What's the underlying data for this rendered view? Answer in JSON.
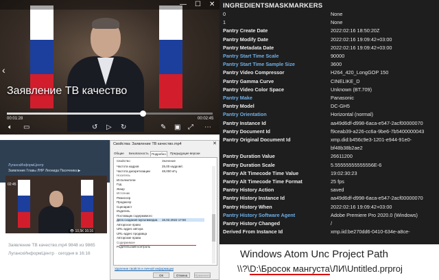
{
  "player": {
    "caption": "Заявление ТВ качество",
    "time_current": "00:01:28",
    "time_total": "00:02:45",
    "progress": 0.66,
    "flag_colors": [
      "#ffffff",
      "#1c3f9e",
      "#d21e2c"
    ]
  },
  "post": {
    "channel_header": "ЛуганскИнформЦентр",
    "subtitle": "Заявление Главы ЛНР Леонида Пасечника ▶",
    "duration": "02:45",
    "video_meta": "👁 10,5К 16:16",
    "file_info": "Заявление ТВ качество.mp4 9848 из 9865",
    "channel_time": "ЛуганскИнформЦентр · сегодня в 16:16"
  },
  "dialog": {
    "title": "Свойства: Заявление ТВ качество.mp4",
    "tabs": [
      "Общие",
      "Безопасность",
      "Подробно",
      "Предыдущие версии"
    ],
    "col_property": "Свойство",
    "col_value": "Значение",
    "rows": [
      {
        "label": "Частота кадров",
        "value": "25,00 кадров/с",
        "kind": "item"
      },
      {
        "label": "Частота дискретизации",
        "value": "48,000 кГц",
        "kind": "item"
      },
      {
        "label": "Носитель",
        "value": "",
        "kind": "group"
      },
      {
        "label": "Исполнители",
        "value": "",
        "kind": "item"
      },
      {
        "label": "Год",
        "value": "",
        "kind": "item"
      },
      {
        "label": "Жанр",
        "value": "",
        "kind": "item"
      },
      {
        "label": "Источник",
        "value": "",
        "kind": "group"
      },
      {
        "label": "Режиссер",
        "value": "",
        "kind": "item"
      },
      {
        "label": "Продюсер",
        "value": "",
        "kind": "item"
      },
      {
        "label": "Сценарист",
        "value": "",
        "kind": "item"
      },
      {
        "label": "Издатель",
        "value": "",
        "kind": "item"
      },
      {
        "label": "Поставщик содержимого",
        "value": "",
        "kind": "item"
      },
      {
        "label": "Дата создания мультимедиа",
        "value": "16.02.2022 17:50",
        "kind": "selected"
      },
      {
        "label": "Авторское право",
        "value": "",
        "kind": "item"
      },
      {
        "label": "URL-адрес автора",
        "value": "",
        "kind": "item"
      },
      {
        "label": "URL-адрес продавца",
        "value": "",
        "kind": "item"
      },
      {
        "label": "Авторские права",
        "value": "",
        "kind": "item"
      },
      {
        "label": "Содержимое",
        "value": "",
        "kind": "group"
      },
      {
        "label": "Родительский контроль",
        "value": "",
        "kind": "item"
      }
    ],
    "remove_link": "Удаление свойств и личной информации",
    "ok": "ОК",
    "cancel": "Отмена",
    "apply": "Применить"
  },
  "meta": {
    "title": "INGREDIENTSMASKMARKERS",
    "rows": [
      {
        "k": "0",
        "v": "None",
        "hl": false,
        "plain": true
      },
      {
        "k": "1",
        "v": "None",
        "hl": false,
        "plain": true
      },
      {
        "k": "Pantry Create Date",
        "v": "2022:02:16 18:50:20Z",
        "hl": false
      },
      {
        "k": "Pantry Modify Date",
        "v": "2022:02:16 19:09:42+03:00",
        "hl": false
      },
      {
        "k": "Pantry Metadata Date",
        "v": "2022:02:16 19:09:42+03:00",
        "hl": false
      },
      {
        "k": "Pantry Start Time Scale",
        "v": "90000",
        "hl": true
      },
      {
        "k": "Pantry Start Time Sample Size",
        "v": "3600",
        "hl": true
      },
      {
        "k": "Pantry Video Compressor",
        "v": "H264_420_LongGOP 150",
        "hl": false
      },
      {
        "k": "Pantry Gamma Curve",
        "v": "CINELIKE_D",
        "hl": false
      },
      {
        "k": "Pantry Video Color Space",
        "v": "Unknown (BT.709)",
        "hl": false
      },
      {
        "k": "Pantry Make",
        "v": "Panasonic",
        "hl": true
      },
      {
        "k": "Pantry Model",
        "v": "DC-GH5",
        "hl": false
      },
      {
        "k": "Pantry Orientation",
        "v": "Horizontal (normal)",
        "hl": true
      },
      {
        "k": "Pantry Instance Id",
        "v": "aa49d6df-d998-6aca-e547-2acf00000070",
        "hl": false
      },
      {
        "k": "Pantry Document Id",
        "v": "f9ceab39-a226-cc6a-9be6-7b5400000043",
        "hl": false
      },
      {
        "k": "Pantry Original Document Id",
        "v": "xmp.did:b456c9e3-1201-e944-91e0-",
        "hl": false
      },
      {
        "k": "",
        "v": "bf48b38b2ae2",
        "hl": false
      },
      {
        "k": "Pantry Duration Value",
        "v": "26611200",
        "hl": false
      },
      {
        "k": "Pantry Duration Scale",
        "v": "5.55555555555556E-6",
        "hl": false
      },
      {
        "k": "Pantry Alt Timecode Time Value",
        "v": "19:02:30:23",
        "hl": false
      },
      {
        "k": "Pantry Alt Timecode Time Format",
        "v": "25 fps",
        "hl": false
      },
      {
        "k": "Pantry History Action",
        "v": "saved",
        "hl": false
      },
      {
        "k": "Pantry History Instance Id",
        "v": "aa49d6df-d998-6aca-e547-2acf00000070",
        "hl": false
      },
      {
        "k": "Pantry History When",
        "v": "2022:02:16 19:09:42+03:00",
        "hl": false
      },
      {
        "k": "Pantry History Software Agent",
        "v": "Adobe Premiere Pro 2020.0 (Windows)",
        "hl": true
      },
      {
        "k": "Pantry History Changed",
        "v": "/",
        "hl": false
      },
      {
        "k": "Derived From Instance Id",
        "v": "xmp.iid:be270dd6-0410-634e-a8ce-",
        "hl": false
      }
    ]
  },
  "callout": {
    "title": "Windows Atom Unc Project Path",
    "path_prefix": "\\\\?\\",
    "path_drive": "D:\\Бросок мангуста",
    "path_suffix": "\\ЛИ\\Untitled.prproj"
  }
}
